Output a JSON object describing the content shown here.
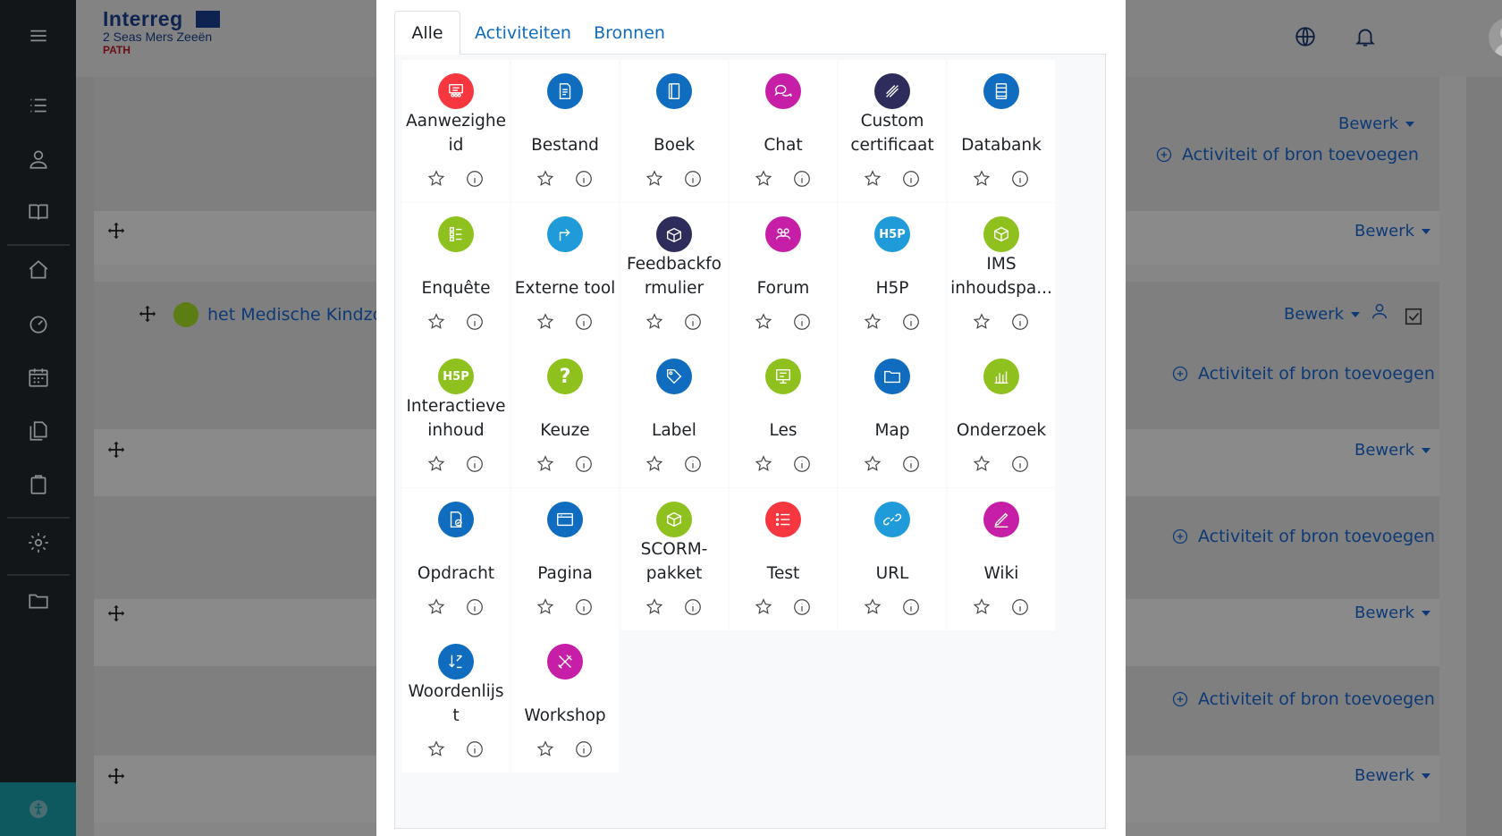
{
  "header": {
    "logo": {
      "line1": "Interreg",
      "line2": "2 Seas Mers Zeeën",
      "line3": "PATH"
    }
  },
  "background": {
    "edit_label": "Bewerk",
    "add_activity_label": "Activiteit of bron toevoegen",
    "activity_name": "het Medische Kindzo"
  },
  "modal": {
    "tabs": [
      {
        "label": "Alle",
        "active": true
      },
      {
        "label": "Activiteiten",
        "active": false
      },
      {
        "label": "Bronnen",
        "active": false
      }
    ],
    "modules": [
      {
        "name": "Aanwezigheid",
        "lines": [
          "Aanwezighe",
          "id"
        ],
        "icon": "attendance-icon",
        "color": "#f7373f"
      },
      {
        "name": "Bestand",
        "lines": [
          "Bestand"
        ],
        "icon": "file-icon",
        "color": "#0f6cbf"
      },
      {
        "name": "Boek",
        "lines": [
          "Boek"
        ],
        "icon": "book-icon",
        "color": "#0f6cbf"
      },
      {
        "name": "Chat",
        "lines": [
          "Chat"
        ],
        "icon": "chat-icon",
        "color": "#c61ea7"
      },
      {
        "name": "Custom certificaat",
        "lines": [
          "Custom",
          "certificaat"
        ],
        "icon": "certificate-icon",
        "color": "#2d2c5a"
      },
      {
        "name": "Databank",
        "lines": [
          "Databank"
        ],
        "icon": "database-icon",
        "color": "#0f6cbf"
      },
      {
        "name": "Enquête",
        "lines": [
          "Enquête"
        ],
        "icon": "survey-icon",
        "color": "#8fc11e"
      },
      {
        "name": "Externe tool",
        "lines": [
          "Externe tool"
        ],
        "icon": "external-tool-icon",
        "color": "#1f9bd9"
      },
      {
        "name": "Feedbackformulier",
        "lines": [
          "Feedbackfo",
          "rmulier"
        ],
        "icon": "feedback-icon",
        "color": "#2d2c5a"
      },
      {
        "name": "Forum",
        "lines": [
          "Forum"
        ],
        "icon": "forum-icon",
        "color": "#c61ea7"
      },
      {
        "name": "H5P",
        "lines": [
          "H5P"
        ],
        "icon": "h5p-icon",
        "color": "#1f9bd9"
      },
      {
        "name": "IMS inhoudspakket",
        "lines": [
          "IMS",
          "inhoudspa..."
        ],
        "icon": "ims-package-icon",
        "color": "#8fc11e"
      },
      {
        "name": "Interactieve inhoud",
        "lines": [
          "Interactieve",
          "inhoud"
        ],
        "icon": "h5p-interactive-icon",
        "color": "#8fc11e"
      },
      {
        "name": "Keuze",
        "lines": [
          "Keuze"
        ],
        "icon": "choice-icon",
        "color": "#8fc11e"
      },
      {
        "name": "Label",
        "lines": [
          "Label"
        ],
        "icon": "label-icon",
        "color": "#0f6cbf"
      },
      {
        "name": "Les",
        "lines": [
          "Les"
        ],
        "icon": "lesson-icon",
        "color": "#8fc11e"
      },
      {
        "name": "Map",
        "lines": [
          "Map"
        ],
        "icon": "folder-icon",
        "color": "#0f6cbf"
      },
      {
        "name": "Onderzoek",
        "lines": [
          "Onderzoek"
        ],
        "icon": "survey-chart-icon",
        "color": "#8fc11e"
      },
      {
        "name": "Opdracht",
        "lines": [
          "Opdracht"
        ],
        "icon": "assignment-icon",
        "color": "#0f6cbf"
      },
      {
        "name": "Pagina",
        "lines": [
          "Pagina"
        ],
        "icon": "page-icon",
        "color": "#0f6cbf"
      },
      {
        "name": "SCORM-pakket",
        "lines": [
          "SCORM-",
          "pakket"
        ],
        "icon": "scorm-icon",
        "color": "#8fc11e"
      },
      {
        "name": "Test",
        "lines": [
          "Test"
        ],
        "icon": "quiz-icon",
        "color": "#f7373f"
      },
      {
        "name": "URL",
        "lines": [
          "URL"
        ],
        "icon": "url-icon",
        "color": "#1f9bd9"
      },
      {
        "name": "Wiki",
        "lines": [
          "Wiki"
        ],
        "icon": "wiki-icon",
        "color": "#c61ea7"
      },
      {
        "name": "Woordenlijst",
        "lines": [
          "Woordenlijs",
          "t"
        ],
        "icon": "glossary-icon",
        "color": "#0f6cbf"
      },
      {
        "name": "Workshop",
        "lines": [
          "Workshop"
        ],
        "icon": "workshop-icon",
        "color": "#c61ea7"
      }
    ]
  }
}
